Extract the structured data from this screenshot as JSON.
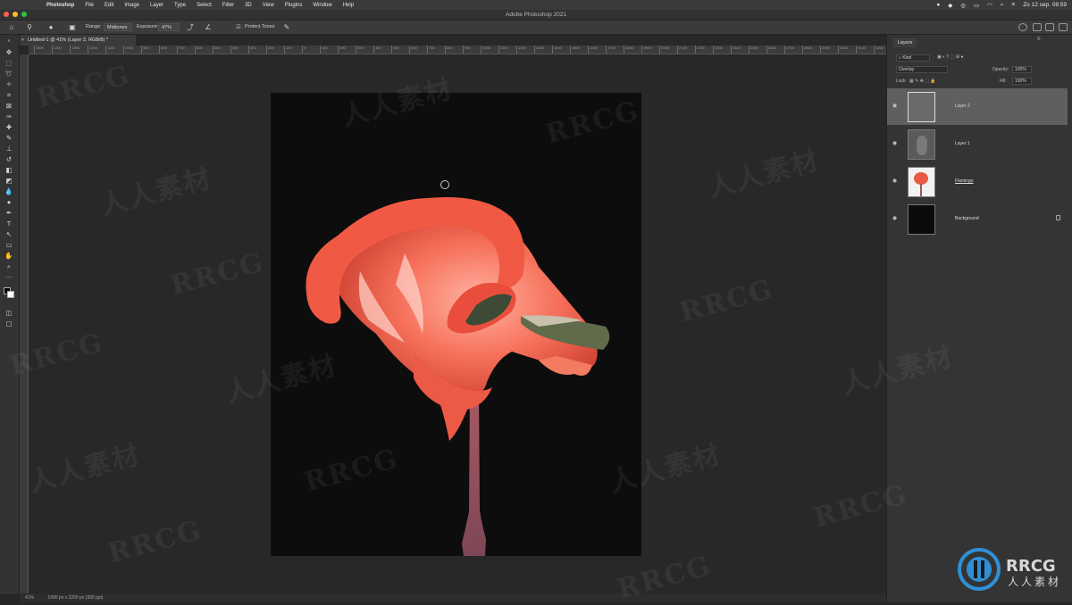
{
  "menubar": {
    "items": [
      "Photoshop",
      "File",
      "Edit",
      "Image",
      "Layer",
      "Type",
      "Select",
      "Filter",
      "3D",
      "View",
      "Plugins",
      "Window",
      "Help"
    ],
    "clock": "Zo 12 sep.  08:59"
  },
  "window": {
    "title": "Adobe Photoshop 2021"
  },
  "options_bar": {
    "mode_label": "Range:",
    "mode_value": "Midtones",
    "exposure_label": "Exposure:",
    "exposure_value": "47%",
    "protect_tones_label": "Protect Tones"
  },
  "document": {
    "tab_label": "Untitled-1 @ 41% (Layer 2, RGB/8) *",
    "status": "41%",
    "status_doc": "1900 px x 2200 px (300 ppi)"
  },
  "ruler": {
    "labels": [
      "1500",
      "1400",
      "1300",
      "1200",
      "1100",
      "1000",
      "900",
      "800",
      "700",
      "600",
      "500",
      "400",
      "300",
      "200",
      "100",
      "0",
      "100",
      "200",
      "300",
      "400",
      "500",
      "600",
      "700",
      "800",
      "900",
      "1000",
      "1100",
      "1200",
      "1300",
      "1400",
      "1500",
      "1600",
      "1700",
      "1800",
      "1900",
      "2000",
      "2100",
      "2200",
      "2300",
      "2400",
      "2500",
      "2600",
      "2700",
      "2800",
      "2900",
      "3000",
      "3100",
      "3200"
    ]
  },
  "layers_panel": {
    "tab": "Layers",
    "filter_kind": "Kind",
    "blend_mode": "Overlay",
    "opacity_label": "Opacity:",
    "opacity_value": "100%",
    "lock_label": "Lock:",
    "fill_label": "Fill:",
    "fill_value": "100%",
    "layers": [
      {
        "name": "Layer 2",
        "selected": true
      },
      {
        "name": "Layer 1",
        "selected": false
      },
      {
        "name": "Flamingo",
        "selected": false
      },
      {
        "name": "Background",
        "selected": false,
        "locked": true
      }
    ]
  },
  "watermark": {
    "brand": "RRCG",
    "cn": "人人素材"
  },
  "colors": {
    "canvas_bg": "#0d0d0d",
    "flamingo": "#f0604a",
    "selected_layer": "#5f5f5f"
  }
}
